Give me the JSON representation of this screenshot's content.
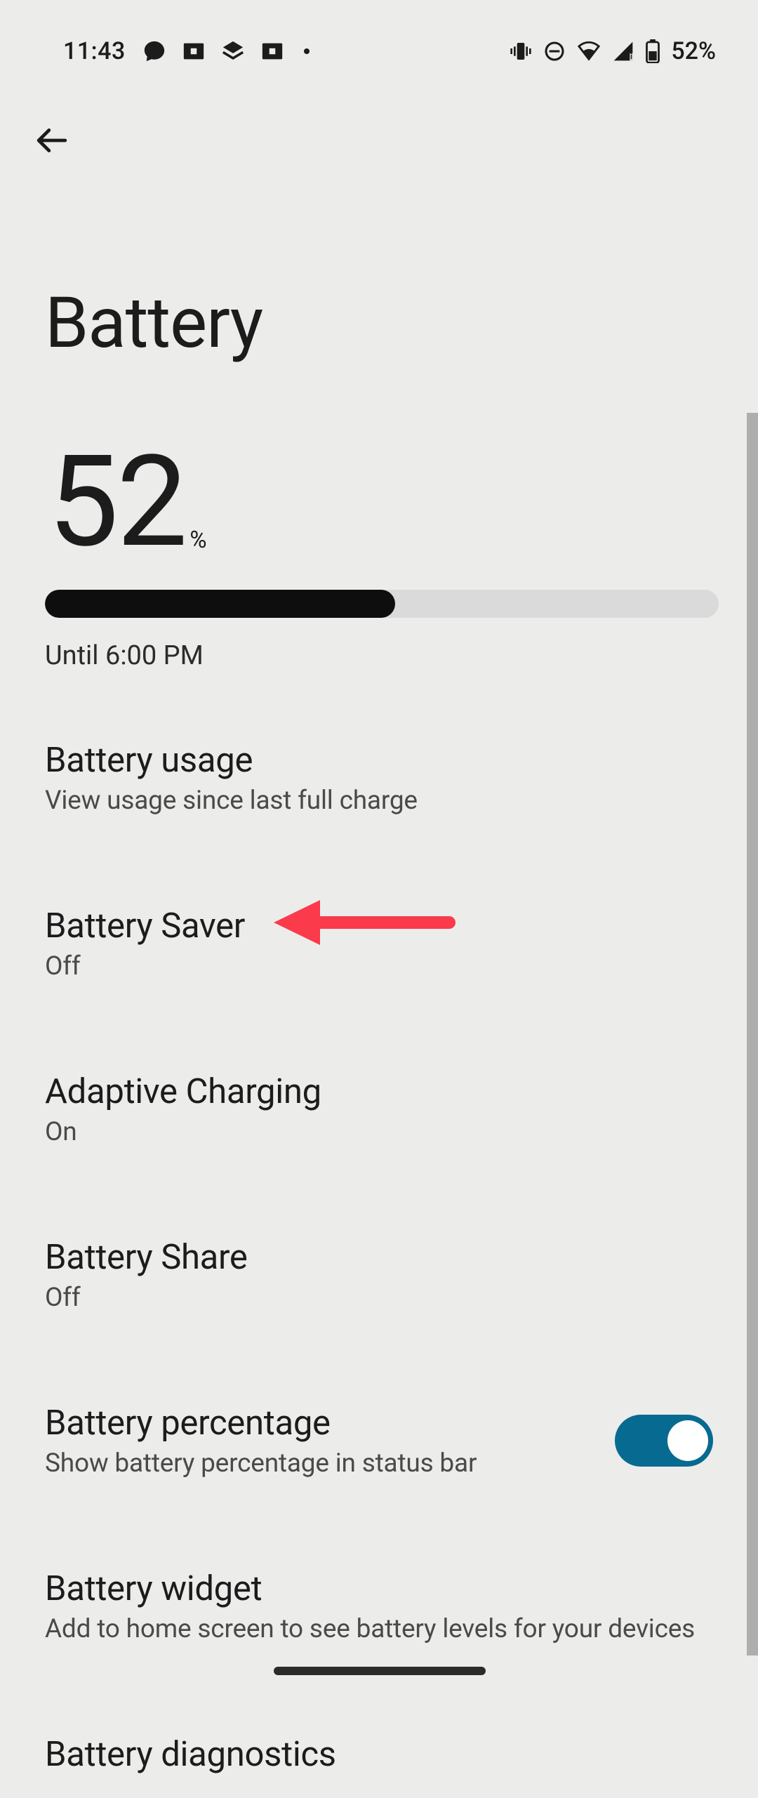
{
  "status": {
    "time": "11:43",
    "battery_text": "52%"
  },
  "header": {
    "title": "Battery"
  },
  "battery": {
    "level_value": "52",
    "level_unit": "%",
    "progress_percent": 52,
    "estimate": "Until 6:00 PM"
  },
  "items": [
    {
      "title": "Battery usage",
      "subtitle": "View usage since last full charge"
    },
    {
      "title": "Battery Saver",
      "subtitle": "Off"
    },
    {
      "title": "Adaptive Charging",
      "subtitle": "On"
    },
    {
      "title": "Battery Share",
      "subtitle": "Off"
    },
    {
      "title": "Battery percentage",
      "subtitle": "Show battery percentage in status bar",
      "toggle": true,
      "toggle_on": true
    },
    {
      "title": "Battery widget",
      "subtitle": "Add to home screen to see battery levels for your devices"
    },
    {
      "title": "Battery diagnostics",
      "subtitle": ""
    }
  ],
  "annotation": {
    "arrow_color": "#fb3a4c",
    "target": "Battery Saver"
  }
}
